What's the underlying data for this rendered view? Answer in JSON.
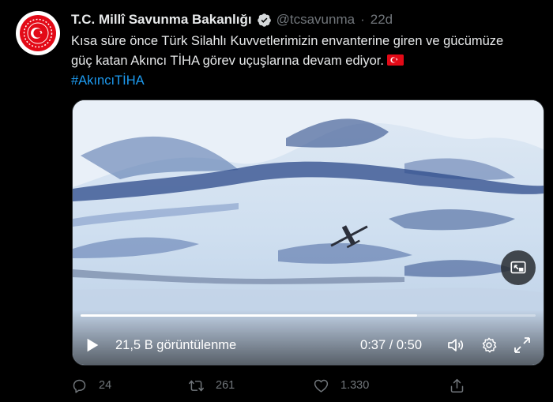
{
  "author": {
    "display_name": "T.C. Millî Savunma Bakanlığı",
    "handle": "@tcsavunma",
    "separator": "·",
    "time": "22d",
    "avatar_icon": "ministry-emblem-icon",
    "verified_icon": "verified-badge-icon"
  },
  "tweet": {
    "line1": "Kısa süre önce Türk Silahlı Kuvvetlerimizin envanterine giren ve gücümüze",
    "line2": "güç katan Akıncı TİHA görev uçuşlarına devam ediyor.",
    "flag_icon": "turkey-flag-icon",
    "hashtag": "#AkıncıTİHA"
  },
  "video": {
    "views": "21,5 B görüntülenme",
    "time": "0:37 / 0:50",
    "progress": 0.74,
    "icons": [
      "play-icon",
      "volume-icon",
      "settings-icon",
      "fullscreen-icon",
      "picture-in-picture-icon"
    ]
  },
  "actions": {
    "reply_count": "24",
    "retweet_count": "261",
    "like_count": "1.330",
    "share_icon": "share-icon"
  },
  "colors": {
    "background": "#000000",
    "text": "#e7e9ea",
    "muted": "#71767b",
    "link": "#1d9bf0",
    "verified": "#1d9bf0",
    "flag": "#e30a17"
  }
}
